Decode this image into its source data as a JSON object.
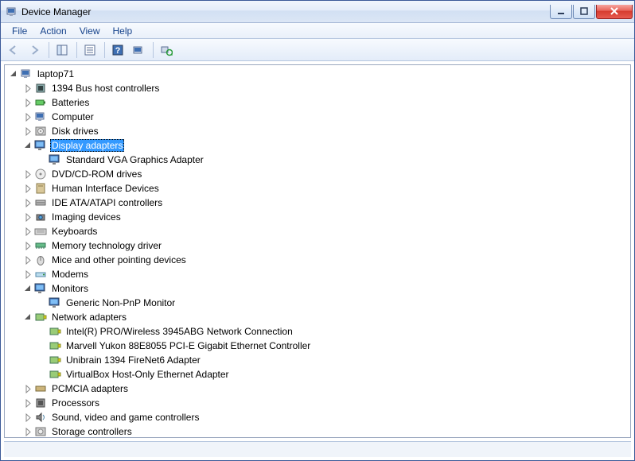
{
  "window": {
    "title": "Device Manager"
  },
  "menu": {
    "file": "File",
    "action": "Action",
    "view": "View",
    "help": "Help"
  },
  "tree": {
    "root": "laptop71",
    "categories": [
      {
        "key": "1394",
        "label": "1394 Bus host controllers",
        "expanded": false,
        "icon": "chip",
        "children": []
      },
      {
        "key": "batt",
        "label": "Batteries",
        "expanded": false,
        "icon": "battery",
        "children": []
      },
      {
        "key": "comp",
        "label": "Computer",
        "expanded": false,
        "icon": "computer",
        "children": []
      },
      {
        "key": "disk",
        "label": "Disk drives",
        "expanded": false,
        "icon": "disk",
        "children": []
      },
      {
        "key": "display",
        "label": "Display adapters",
        "expanded": true,
        "icon": "display",
        "selected": true,
        "children": [
          {
            "label": "Standard VGA Graphics Adapter",
            "icon": "display"
          }
        ]
      },
      {
        "key": "dvd",
        "label": "DVD/CD-ROM drives",
        "expanded": false,
        "icon": "dvd",
        "children": []
      },
      {
        "key": "hid",
        "label": "Human Interface Devices",
        "expanded": false,
        "icon": "hid",
        "children": []
      },
      {
        "key": "ide",
        "label": "IDE ATA/ATAPI controllers",
        "expanded": false,
        "icon": "ide",
        "children": []
      },
      {
        "key": "imaging",
        "label": "Imaging devices",
        "expanded": false,
        "icon": "camera",
        "children": []
      },
      {
        "key": "keyb",
        "label": "Keyboards",
        "expanded": false,
        "icon": "keyboard",
        "children": []
      },
      {
        "key": "memt",
        "label": "Memory technology driver",
        "expanded": false,
        "icon": "memory",
        "children": []
      },
      {
        "key": "mice",
        "label": "Mice and other pointing devices",
        "expanded": false,
        "icon": "mouse",
        "children": []
      },
      {
        "key": "modems",
        "label": "Modems",
        "expanded": false,
        "icon": "modem",
        "children": []
      },
      {
        "key": "monitors",
        "label": "Monitors",
        "expanded": true,
        "icon": "monitor",
        "children": [
          {
            "label": "Generic Non-PnP Monitor",
            "icon": "monitor"
          }
        ]
      },
      {
        "key": "net",
        "label": "Network adapters",
        "expanded": true,
        "icon": "nic",
        "children": [
          {
            "label": "Intel(R) PRO/Wireless 3945ABG Network Connection",
            "icon": "nic"
          },
          {
            "label": "Marvell Yukon 88E8055 PCI-E Gigabit Ethernet Controller",
            "icon": "nic"
          },
          {
            "label": "Unibrain 1394 FireNet6 Adapter",
            "icon": "nic"
          },
          {
            "label": "VirtualBox Host-Only Ethernet Adapter",
            "icon": "nic"
          }
        ]
      },
      {
        "key": "pcmcia",
        "label": "PCMCIA adapters",
        "expanded": false,
        "icon": "pcmcia",
        "children": []
      },
      {
        "key": "cpu",
        "label": "Processors",
        "expanded": false,
        "icon": "cpu",
        "children": []
      },
      {
        "key": "sound",
        "label": "Sound, video and game controllers",
        "expanded": false,
        "icon": "sound",
        "children": []
      },
      {
        "key": "storage",
        "label": "Storage controllers",
        "expanded": false,
        "icon": "storage",
        "children": []
      }
    ]
  }
}
